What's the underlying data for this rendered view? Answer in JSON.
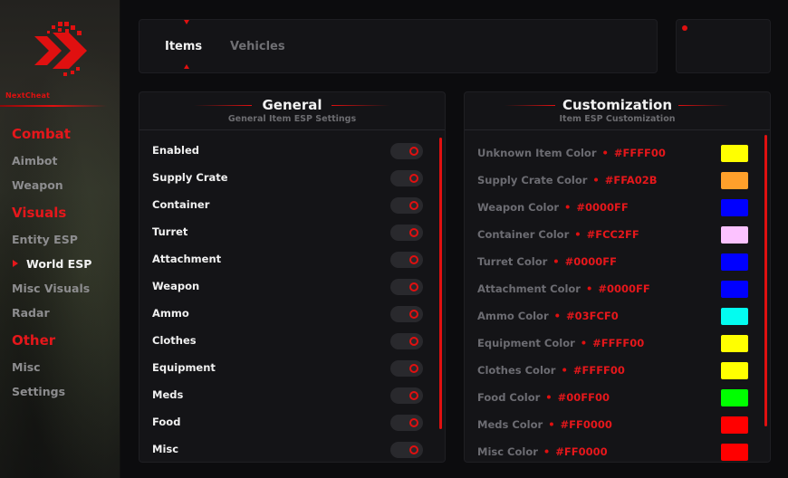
{
  "brand": {
    "name": "NextCheat"
  },
  "sidebar": {
    "sections": [
      {
        "label": "Combat",
        "items": [
          "Aimbot",
          "Weapon"
        ]
      },
      {
        "label": "Visuals",
        "items": [
          "Entity ESP",
          "World ESP",
          "Misc Visuals",
          "Radar"
        ]
      },
      {
        "label": "Other",
        "items": [
          "Misc",
          "Settings"
        ]
      }
    ],
    "active_item": "World ESP"
  },
  "tabs": [
    {
      "label": "Items",
      "active": true
    },
    {
      "label": "Vehicles",
      "active": false
    }
  ],
  "general": {
    "title": "General",
    "subtitle": "General Item ESP Settings",
    "toggles": [
      {
        "label": "Enabled"
      },
      {
        "label": "Supply Crate"
      },
      {
        "label": "Container"
      },
      {
        "label": "Turret"
      },
      {
        "label": "Attachment"
      },
      {
        "label": "Weapon"
      },
      {
        "label": "Ammo"
      },
      {
        "label": "Clothes"
      },
      {
        "label": "Equipment"
      },
      {
        "label": "Meds"
      },
      {
        "label": "Food"
      },
      {
        "label": "Misc"
      }
    ]
  },
  "customization": {
    "title": "Customization",
    "subtitle": "Item ESP Customization",
    "colors": [
      {
        "label": "Unknown Item Color",
        "hex": "#FFFF00"
      },
      {
        "label": "Supply Crate Color",
        "hex": "#FFA02B"
      },
      {
        "label": "Weapon Color",
        "hex": "#0000FF"
      },
      {
        "label": "Container Color",
        "hex": "#FCC2FF"
      },
      {
        "label": "Turret Color",
        "hex": "#0000FF"
      },
      {
        "label": "Attachment Color",
        "hex": "#0000FF"
      },
      {
        "label": "Ammo Color",
        "hex": "#03FCF0"
      },
      {
        "label": "Equipment Color",
        "hex": "#FFFF00"
      },
      {
        "label": "Clothes Color",
        "hex": "#FFFF00"
      },
      {
        "label": "Food Color",
        "hex": "#00FF00"
      },
      {
        "label": "Meds Color",
        "hex": "#FF0000"
      },
      {
        "label": "Misc Color",
        "hex": "#FF0000"
      }
    ]
  },
  "theme": {
    "accent": "#E01010",
    "background": "#0C0C0E",
    "panel": "#141417"
  }
}
